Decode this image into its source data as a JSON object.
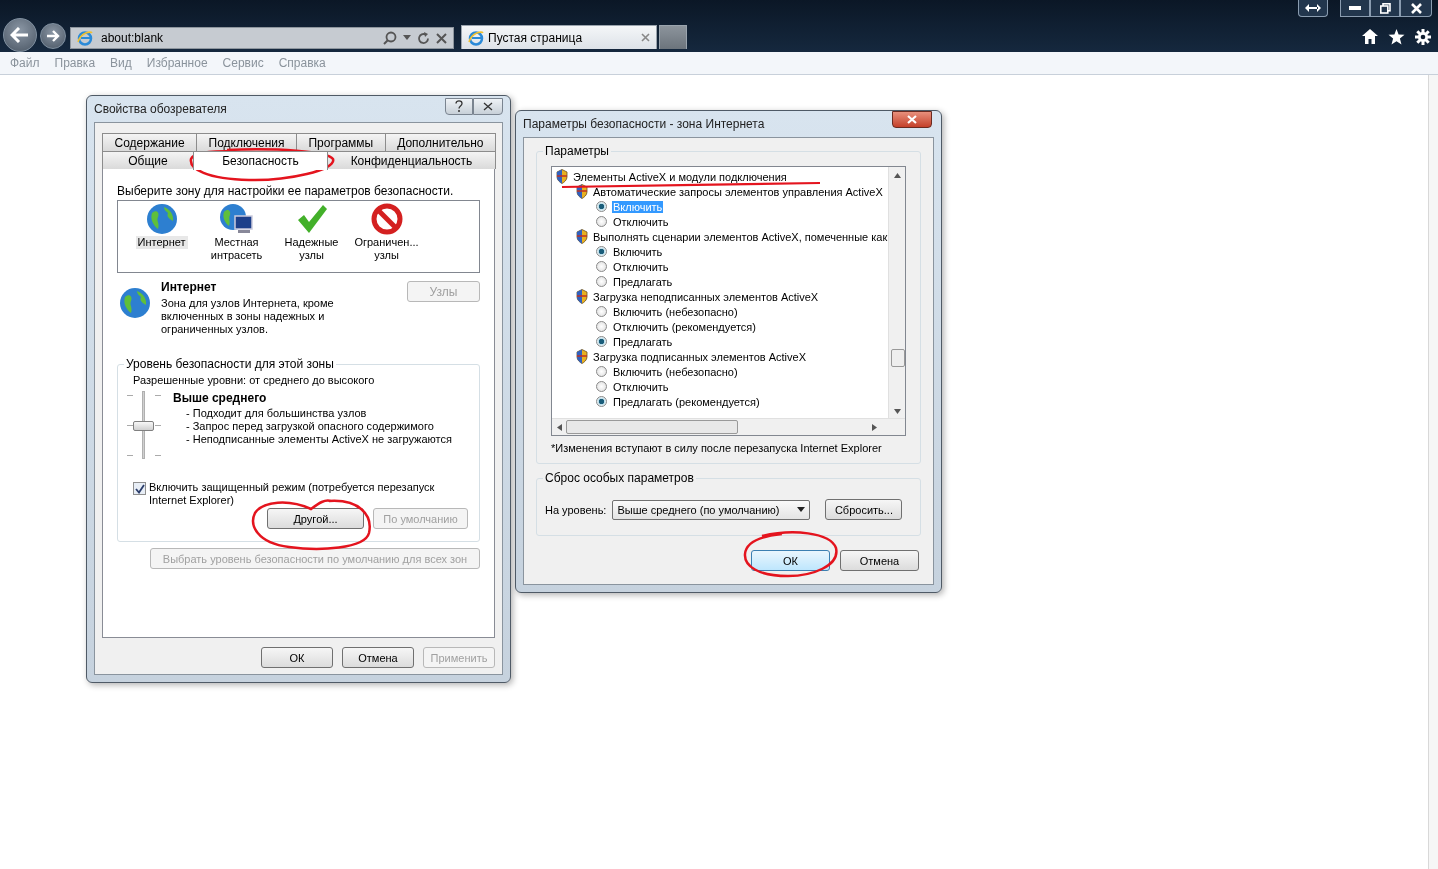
{
  "browser": {
    "address": "about:blank",
    "tab": "Пустая страница",
    "menu": [
      "Файл",
      "Правка",
      "Вид",
      "Избранное",
      "Сервис",
      "Справка"
    ]
  },
  "internet_options": {
    "title": "Свойства обозревателя",
    "tabs_top": [
      {
        "label": "Содержание",
        "selected": false
      },
      {
        "label": "Подключения",
        "selected": false
      },
      {
        "label": "Программы",
        "selected": false
      },
      {
        "label": "Дополнительно",
        "selected": false
      }
    ],
    "tabs_bottom": [
      {
        "label": "Общие",
        "selected": false
      },
      {
        "label": "Безопасность",
        "selected": true
      },
      {
        "label": "Конфиденциальность",
        "selected": false
      }
    ],
    "zone_prompt": "Выберите зону для настройки ее параметров безопасности.",
    "zones": [
      {
        "kind": "internet",
        "label": "Интернет",
        "selected": true
      },
      {
        "kind": "intranet",
        "label": "Местная\nинтрасеть",
        "selected": false
      },
      {
        "kind": "trusted",
        "label": "Надежные\nузлы",
        "selected": false
      },
      {
        "kind": "restricted",
        "label": "Ограничен...\nузлы",
        "selected": false
      }
    ],
    "zone_name": "Интернет",
    "zone_description": "Зона для узлов Интернета, кроме включенных в зоны надежных и ограниченных узлов.",
    "sites_button": {
      "label": "Узлы",
      "disabled": true
    },
    "level_group": "Уровень безопасности для этой зоны",
    "allowed_levels": "Разрешенные уровни: от среднего до высокого",
    "slider": {
      "level": 0.5
    },
    "level_name": "Выше среднего",
    "level_points": [
      "- Подходит для большинства узлов",
      "- Запрос перед загрузкой опасного содержимого",
      "- Неподписанные элементы ActiveX не загружаются"
    ],
    "protected_mode": {
      "label": "Включить защищенный режим (потребуется перезапуск Internet Explorer)",
      "checked": true
    },
    "level_buttons": [
      {
        "label": "Другой...",
        "disabled": false
      },
      {
        "label": "По умолчанию",
        "disabled": true
      }
    ],
    "reset_all": {
      "label": "Выбрать уровень безопасности по умолчанию для всех зон",
      "disabled": true
    },
    "buttons": [
      {
        "label": "ОК",
        "disabled": false
      },
      {
        "label": "Отмена",
        "disabled": false
      },
      {
        "label": "Применить",
        "disabled": true
      }
    ]
  },
  "security_settings": {
    "title": "Параметры безопасности - зона Интернета",
    "group": "Параметры",
    "tree": [
      {
        "kind": "category",
        "label": "Элементы ActiveX и модули подключения",
        "children": [
          {
            "kind": "setting",
            "label": "Автоматические запросы элементов управления ActiveX",
            "children": [
              {
                "kind": "radio",
                "label": "Включить",
                "selected": true,
                "highlighted": true
              },
              {
                "kind": "radio",
                "label": "Отключить",
                "selected": false,
                "highlighted": false
              }
            ]
          },
          {
            "kind": "setting",
            "label": "Выполнять сценарии элементов ActiveX, помеченные как",
            "children": [
              {
                "kind": "radio",
                "label": "Включить",
                "selected": true,
                "highlighted": false
              },
              {
                "kind": "radio",
                "label": "Отключить",
                "selected": false,
                "highlighted": false
              },
              {
                "kind": "radio",
                "label": "Предлагать",
                "selected": false,
                "highlighted": false
              }
            ]
          },
          {
            "kind": "setting",
            "label": "Загрузка неподписанных элементов ActiveX",
            "children": [
              {
                "kind": "radio",
                "label": "Включить (небезопасно)",
                "selected": false,
                "highlighted": false
              },
              {
                "kind": "radio",
                "label": "Отключить (рекомендуется)",
                "selected": false,
                "highlighted": false
              },
              {
                "kind": "radio",
                "label": "Предлагать",
                "selected": true,
                "highlighted": false
              }
            ]
          },
          {
            "kind": "setting",
            "label": "Загрузка подписанных элементов ActiveX",
            "children": [
              {
                "kind": "radio",
                "label": "Включить (небезопасно)",
                "selected": false,
                "highlighted": false
              },
              {
                "kind": "radio",
                "label": "Отключить",
                "selected": false,
                "highlighted": false
              },
              {
                "kind": "radio",
                "label": "Предлагать (рекомендуется)",
                "selected": true,
                "highlighted": false
              }
            ]
          }
        ]
      }
    ],
    "note": "*Изменения вступают в силу после перезапуска Internet Explorer",
    "reset_group": "Сброс особых параметров",
    "reset_label": "На уровень:",
    "reset_value": "Выше среднего (по умолчанию)",
    "reset_button": "Сбросить...",
    "buttons": [
      {
        "label": "ОК",
        "default": true
      },
      {
        "label": "Отмена",
        "default": false
      }
    ]
  }
}
